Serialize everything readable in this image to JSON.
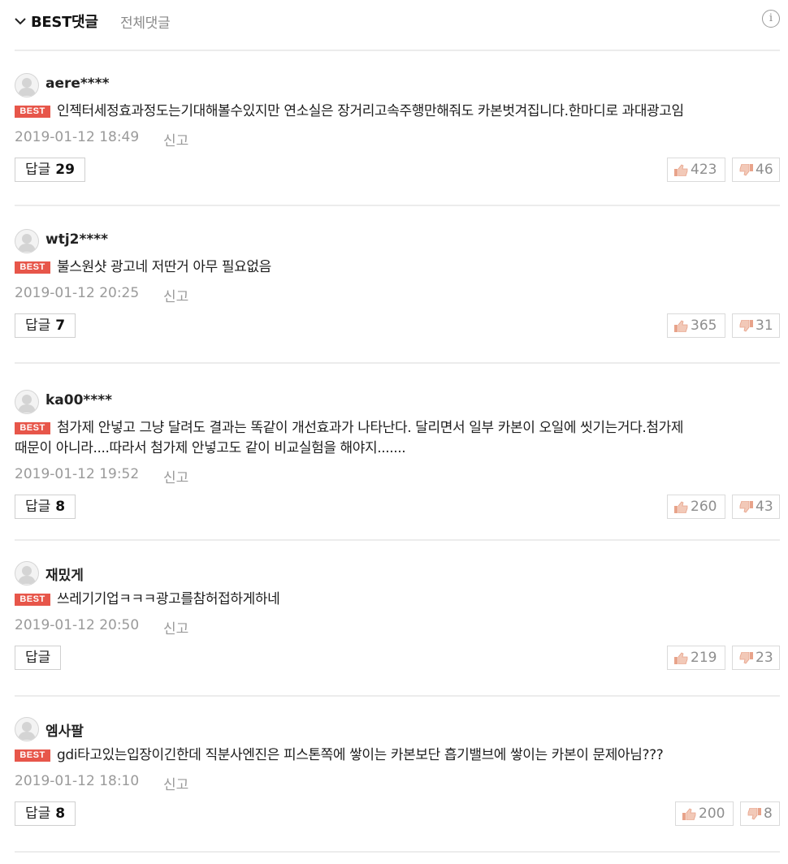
{
  "header": {
    "best_tab": "BEST댓글",
    "all_tab": "전체댓글",
    "info_glyph": "i"
  },
  "badge_label": "BEST",
  "report_label": "신고",
  "reply_label": "답글",
  "colors": {
    "best_badge": "#e7564a",
    "muted_text": "#9a9a9a",
    "thumb_icon": "#e8a38a"
  },
  "icons": [
    "chevron-down-icon",
    "info-icon",
    "avatar-icon",
    "thumbs-up-icon",
    "thumbs-down-icon"
  ],
  "comments": [
    {
      "nickname": "aere****",
      "lines": [
        "인젝터세정효과정도는기대해볼수있지만 연소실은 장거리고속주행만해줘도 카본벗겨집니다.한마디로 과대광고임"
      ],
      "datetime": "2019-01-12 18:49",
      "reply_count": "29",
      "likes": "423",
      "dislikes": "46"
    },
    {
      "nickname": "wtj2****",
      "lines": [
        "불스원샷 광고네 저딴거 아무 필요없음"
      ],
      "datetime": "2019-01-12 20:25",
      "reply_count": "7",
      "likes": "365",
      "dislikes": "31"
    },
    {
      "nickname": "ka00****",
      "lines": [
        "첨가제 안넣고 그냥 달려도 결과는 똑같이 개선효과가 나타난다. 달리면서 일부 카본이 오일에 씻기는거다.첨가제",
        "때문이 아니라....따라서 첨가제 안넣고도 같이 비교실험을 해야지......."
      ],
      "datetime": "2019-01-12 19:52",
      "reply_count": "8",
      "likes": "260",
      "dislikes": "43"
    },
    {
      "nickname": "재밌게",
      "lines": [
        "쓰레기기업ㅋㅋㅋ광고를참허접하게하네"
      ],
      "datetime": "2019-01-12 20:50",
      "reply_count": "",
      "likes": "219",
      "dislikes": "23"
    },
    {
      "nickname": "엠사팔",
      "lines": [
        "gdi타고있는입장이긴한데 직분사엔진은 피스톤쪽에 쌓이는 카본보단 흡기밸브에 쌓이는 카본이 문제아님???"
      ],
      "datetime": "2019-01-12 18:10",
      "reply_count": "8",
      "likes": "200",
      "dislikes": "8"
    }
  ]
}
